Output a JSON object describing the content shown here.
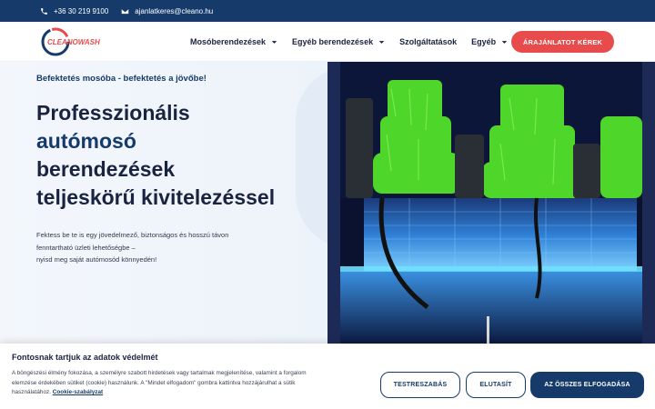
{
  "topbar": {
    "phone": "+36 30 219 9100",
    "email": "ajanlatkeres@cleano.hu",
    "phone_icon": "phone-icon",
    "email_icon": "envelope-icon"
  },
  "header": {
    "logo_text": "CLEANOWASH",
    "nav": [
      {
        "label": "Mosóberendezések",
        "has_dropdown": true
      },
      {
        "label": "Egyéb berendezések",
        "has_dropdown": true
      },
      {
        "label": "Szolgáltatások",
        "has_dropdown": false
      },
      {
        "label": "Egyéb",
        "has_dropdown": true
      }
    ],
    "cta_label": "ÁRAJÁNLATOT KÉREK"
  },
  "hero": {
    "tagline": "Befektetés mosóba - befektetés a jövőbe!",
    "headline_line1": "Professzionális",
    "headline_accent": "autómosó",
    "headline_line3": "berendezések",
    "headline_line4": "teljeskörű kivitelezéssel",
    "lead_line1": "Fektess be te is egy jövedelmező, biztonságos és hosszú távon",
    "lead_line2": "fenntartható üzleti lehetőségbe –",
    "lead_line3": "nyisd meg saját autómosód könnyedén!"
  },
  "cookie": {
    "title": "Fontosnak tartjuk az adatok védelmét",
    "text_line1": "A böngészési élmény fokozása, a személyre szabott hirdetések vagy tartalmak megjelenítése, valamint a forgalom",
    "text_line2": "elemzése érdekében sütiket (cookie) használunk. A \"Mindet elfogadom\" gombra kattintva hozzájárulhat a sütik",
    "text_line3_prefix": "használatához.",
    "policy_link": "Cookie-szabályzat",
    "btn_customize": "TESTRESZABÁS",
    "btn_reject": "ELUTASÍT",
    "btn_accept_all": "AZ ÖSSZES ELFOGADÁSA"
  },
  "colors": {
    "primary": "#163b6b",
    "cta": "#e84b4b",
    "brush_green": "#4fd62a",
    "wall_blue": "#3fb8ff"
  }
}
